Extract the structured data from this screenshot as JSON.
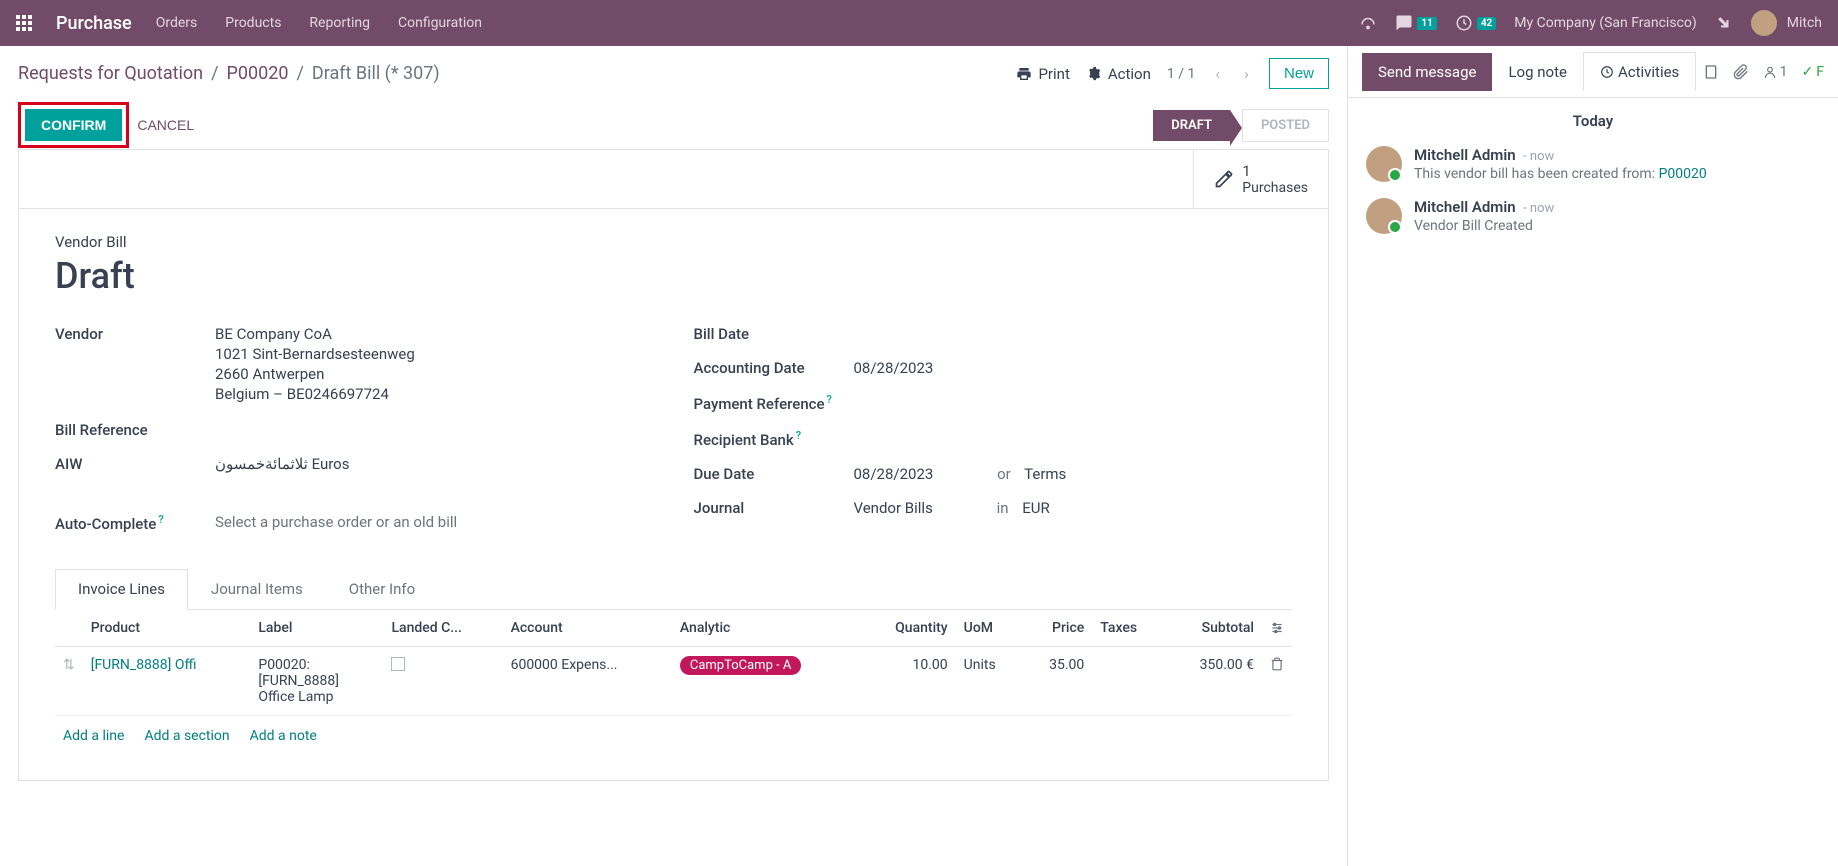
{
  "topbar": {
    "app_name": "Purchase",
    "menu": [
      "Orders",
      "Products",
      "Reporting",
      "Configuration"
    ],
    "msg_badge": "11",
    "clock_badge": "42",
    "company": "My Company (San Francisco)",
    "user": "Mitch"
  },
  "breadcrumb": {
    "crumbs": [
      "Requests for Quotation",
      "P00020"
    ],
    "active": "Draft Bill (* 307)",
    "print": "Print",
    "action": "Action",
    "pager": "1 / 1",
    "new": "New"
  },
  "actions": {
    "confirm": "CONFIRM",
    "cancel": "CANCEL",
    "status_current": "DRAFT",
    "status_next": "POSTED"
  },
  "stat": {
    "count": "1",
    "label": "Purchases"
  },
  "doc": {
    "type_label": "Vendor Bill",
    "title": "Draft"
  },
  "fields": {
    "vendor_label": "Vendor",
    "vendor_name": "BE Company CoA",
    "vendor_addr1": "1021 Sint-Bernardsesteenweg",
    "vendor_addr2": "2660 Antwerpen",
    "vendor_addr3": "Belgium – BE0246697724",
    "bill_ref_label": "Bill Reference",
    "aiw_label": "AIW",
    "aiw_value": "ثلاثمائةخمسون Euros",
    "autocomplete_label": "Auto-Complete",
    "autocomplete_placeholder": "Select a purchase order or an old bill",
    "bill_date_label": "Bill Date",
    "accounting_date_label": "Accounting Date",
    "accounting_date_value": "08/28/2023",
    "payment_ref_label": "Payment Reference",
    "recipient_bank_label": "Recipient Bank",
    "due_date_label": "Due Date",
    "due_date_value": "08/28/2023",
    "due_date_or": "or",
    "due_date_terms": "Terms",
    "journal_label": "Journal",
    "journal_value": "Vendor Bills",
    "journal_in": "in",
    "journal_currency": "EUR"
  },
  "tabs": [
    "Invoice Lines",
    "Journal Items",
    "Other Info"
  ],
  "table": {
    "headers": {
      "product": "Product",
      "label": "Label",
      "landed": "Landed C...",
      "account": "Account",
      "analytic": "Analytic",
      "qty": "Quantity",
      "uom": "UoM",
      "price": "Price",
      "taxes": "Taxes",
      "subtotal": "Subtotal"
    },
    "row": {
      "product": "[FURN_8888] Offi",
      "label_l1": "P00020:",
      "label_l2": "[FURN_8888]",
      "label_l3": "Office Lamp",
      "account": "600000 Expens...",
      "analytic": "CampToCamp - A",
      "qty": "10.00",
      "uom": "Units",
      "price": "35.00",
      "subtotal": "350.00 €"
    },
    "add_line": "Add a line",
    "add_section": "Add a section",
    "add_note": "Add a note"
  },
  "chatter": {
    "send": "Send message",
    "log": "Log note",
    "activities": "Activities",
    "follower_count": "1",
    "follow_text": "F",
    "today": "Today",
    "entries": [
      {
        "author": "Mitchell Admin",
        "time": "- now",
        "msg_prefix": "This vendor bill has been created from: ",
        "msg_link": "P00020"
      },
      {
        "author": "Mitchell Admin",
        "time": "- now",
        "msg_prefix": "Vendor Bill Created",
        "msg_link": ""
      }
    ]
  }
}
